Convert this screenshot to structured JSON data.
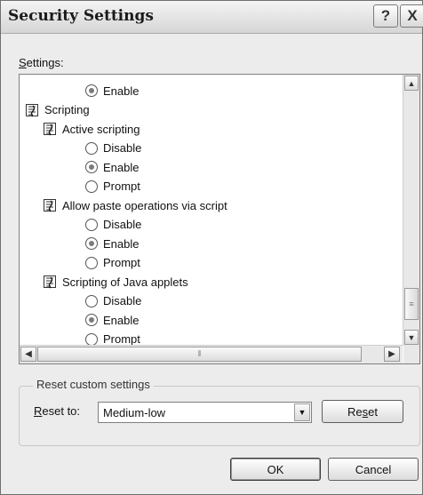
{
  "window": {
    "title": "Security Settings",
    "help_label": "?",
    "close_label": "X"
  },
  "settings_label": "Settings:",
  "tree": [
    {
      "kind": "radio",
      "level": 2,
      "label": "Enable",
      "checked": true
    },
    {
      "kind": "category",
      "level": 0,
      "label": "Scripting"
    },
    {
      "kind": "category",
      "level": 1,
      "label": "Active scripting"
    },
    {
      "kind": "radio",
      "level": 2,
      "label": "Disable",
      "checked": false
    },
    {
      "kind": "radio",
      "level": 2,
      "label": "Enable",
      "checked": true
    },
    {
      "kind": "radio",
      "level": 2,
      "label": "Prompt",
      "checked": false
    },
    {
      "kind": "category",
      "level": 1,
      "label": "Allow paste operations via script"
    },
    {
      "kind": "radio",
      "level": 2,
      "label": "Disable",
      "checked": false
    },
    {
      "kind": "radio",
      "level": 2,
      "label": "Enable",
      "checked": true
    },
    {
      "kind": "radio",
      "level": 2,
      "label": "Prompt",
      "checked": false
    },
    {
      "kind": "category",
      "level": 1,
      "label": "Scripting of Java applets"
    },
    {
      "kind": "radio",
      "level": 2,
      "label": "Disable",
      "checked": false
    },
    {
      "kind": "radio",
      "level": 2,
      "label": "Enable",
      "checked": true
    },
    {
      "kind": "radio",
      "level": 2,
      "label": "Prompt",
      "checked": false
    }
  ],
  "reset_group": {
    "legend": "Reset custom settings",
    "reset_to_label": "Reset to:",
    "selected_level": "Medium-low",
    "reset_button": "Reset"
  },
  "buttons": {
    "ok": "OK",
    "cancel": "Cancel"
  }
}
